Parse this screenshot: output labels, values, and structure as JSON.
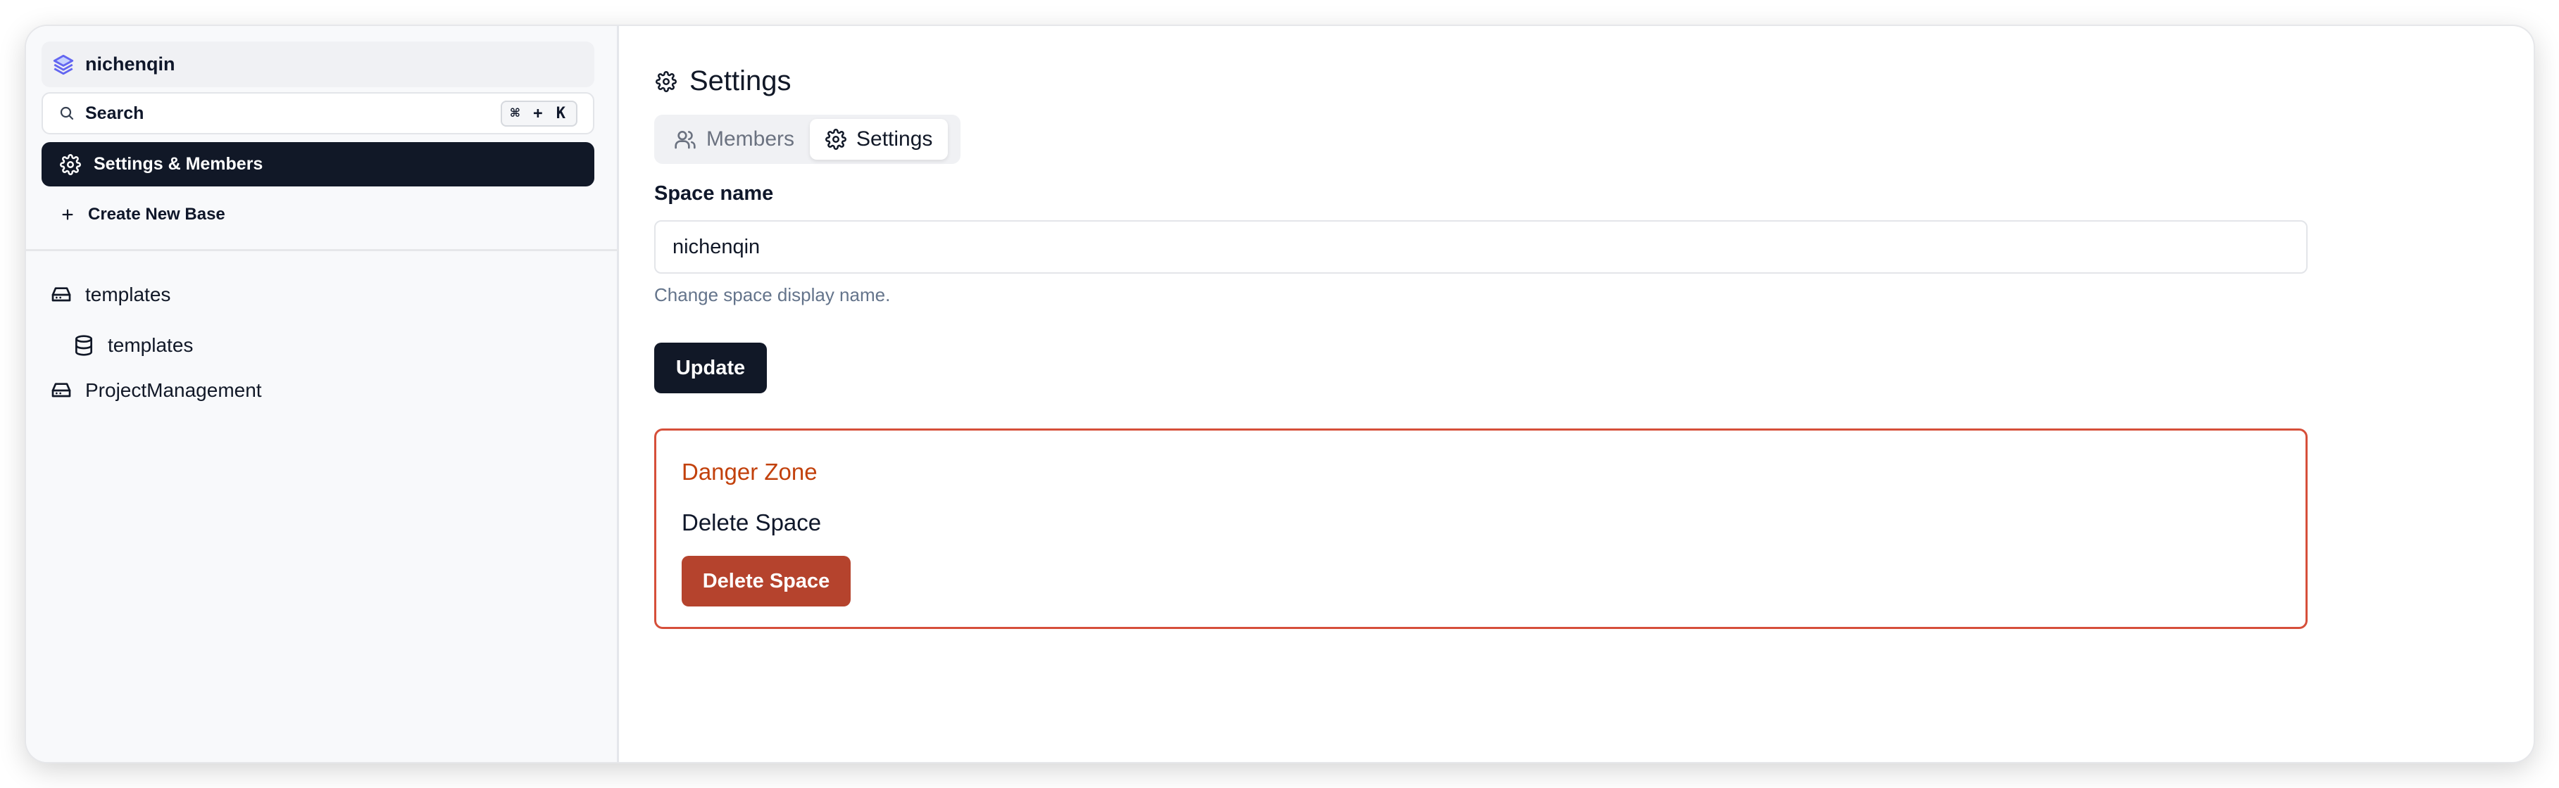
{
  "sidebar": {
    "space_name": "nichenqin",
    "search": {
      "label": "Search",
      "shortcut": "⌘ + K"
    },
    "nav_active_label": "Settings & Members",
    "create_base_label": "Create New Base",
    "tree": [
      {
        "label": "templates",
        "icon": "base-icon"
      },
      {
        "label": "templates",
        "icon": "table-icon"
      },
      {
        "label": "ProjectManagement",
        "icon": "base-icon"
      }
    ]
  },
  "main": {
    "title": "Settings",
    "tabs": [
      {
        "label": "Members",
        "icon": "users-icon",
        "active": false
      },
      {
        "label": "Settings",
        "icon": "gear-icon",
        "active": true
      }
    ],
    "space_name_label": "Space name",
    "space_name_value": "nichenqin",
    "help_text": "Change space display name.",
    "update_label": "Update",
    "danger_zone": {
      "title": "Danger Zone",
      "subtitle": "Delete Space",
      "button_label": "Delete Space"
    }
  },
  "colors": {
    "active_nav_bg": "#111827",
    "danger_border": "#d64f3a",
    "danger_button": "#b5432d",
    "accent_logo": "#6366f1"
  }
}
